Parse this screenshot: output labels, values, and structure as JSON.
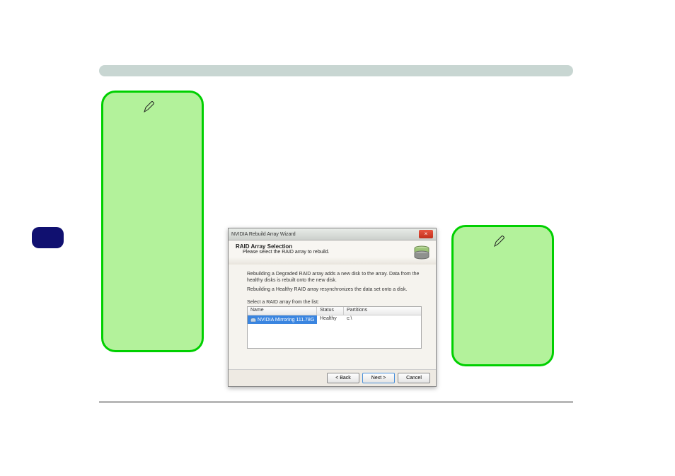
{
  "dialog": {
    "window_title": "NVIDIA Rebuild Array Wizard",
    "close_glyph": "×",
    "heading": "RAID Array Selection",
    "subheading": "Please select the RAID array to rebuild.",
    "icon_name": "disk-stack-icon",
    "body_para1": "Rebuilding a Degraded RAID array adds a new disk to the array. Data from the healthy disks is rebuilt onto the new disk.",
    "body_para2": "Rebuilding a Healthy RAID array resynchronizes the data set onto a disk.",
    "list_label": "Select a RAID array from the list:",
    "columns": {
      "name": "Name",
      "status": "Status",
      "partitions": "Partitions"
    },
    "rows": [
      {
        "name": "NVIDIA Mirroring 111.78G",
        "status": "Healthy",
        "partitions": "c:\\"
      }
    ],
    "buttons": {
      "back": "< Back",
      "next": "Next >",
      "cancel": "Cancel"
    }
  },
  "callouts": {
    "left_icon": "pen-icon",
    "right_icon": "pen-icon"
  }
}
